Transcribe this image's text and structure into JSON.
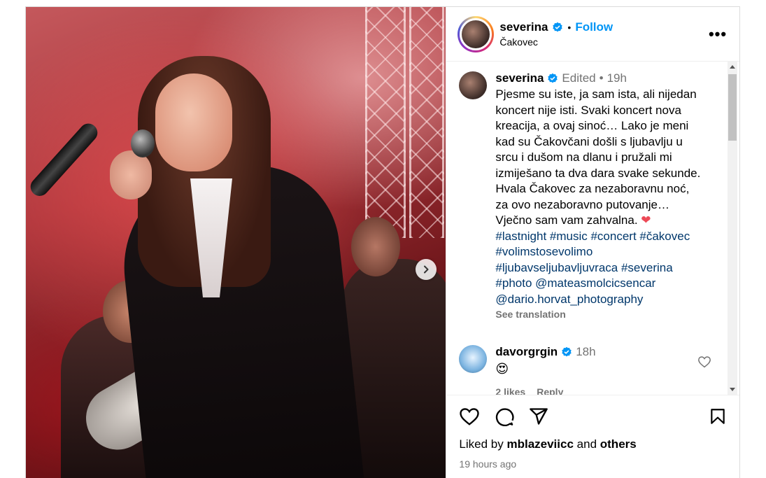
{
  "post": {
    "username": "severina",
    "follow_label": "Follow",
    "location": "Čakovec",
    "more_label": "•••"
  },
  "caption": {
    "username": "severina",
    "edited": "Edited",
    "time": "19h",
    "text": "Pjesme su iste, ja sam ista, ali nijedan koncert nije isti. Svaki koncert nova kreacija, a ovaj sinoć… Lako je meni kad su Čakovčani došli s ljubavlju u srcu i dušom na dlanu i pružali mi izmiješano ta dva dara svake sekunde. Hvala Čakovec za nezaboravnu noć, za ovo nezaboravno putovanje… Vječno sam vam zahvalna.",
    "heart": "❤",
    "tags": "#lastnight #music #concert #čakovec #volimstosevolimo #ljubavseljubavljuvraca #severina #photo @mateasmolcicsencar @dario.horvat_photography",
    "see_translation": "See translation"
  },
  "comments": [
    {
      "username": "davorgrgin",
      "time": "18h",
      "text": "😍",
      "likes": "2 likes",
      "reply": "Reply"
    }
  ],
  "likes": {
    "prefix": "Liked by",
    "user": "mblazeviicc",
    "and": "and",
    "others": "others"
  },
  "posted_ago": "19 hours ago",
  "colors": {
    "accent": "#0095f6",
    "hashtag": "#00376b",
    "muted": "#737373",
    "verified": "#0095f6"
  },
  "icons": [
    "verified-badge-icon",
    "more-icon",
    "next-arrow-icon",
    "heart-icon",
    "comment-icon",
    "share-icon",
    "bookmark-icon",
    "small-heart-icon"
  ]
}
